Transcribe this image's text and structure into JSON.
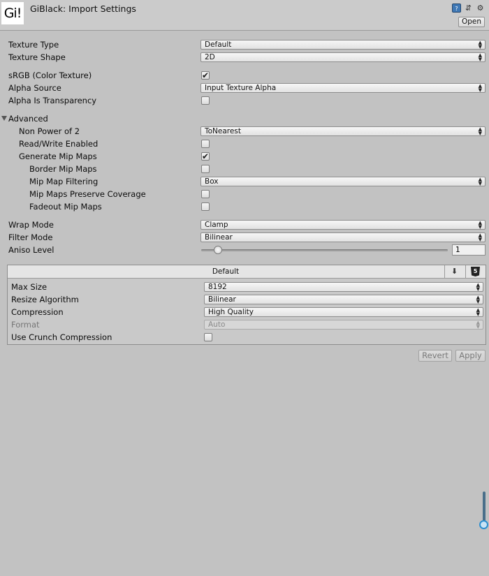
{
  "header": {
    "logo_text": "Gi!",
    "title": "GiBlack: Import Settings",
    "open_label": "Open",
    "icons": [
      "help-book-icon",
      "preset-sliders-icon",
      "settings-gear-icon"
    ]
  },
  "fields": {
    "texture_type": {
      "label": "Texture Type",
      "value": "Default"
    },
    "texture_shape": {
      "label": "Texture Shape",
      "value": "2D"
    },
    "srgb": {
      "label": "sRGB (Color Texture)",
      "checked": true
    },
    "alpha_source": {
      "label": "Alpha Source",
      "value": "Input Texture Alpha"
    },
    "alpha_is_transparency": {
      "label": "Alpha Is Transparency",
      "checked": false
    },
    "advanced": {
      "label": "Advanced",
      "expanded": true
    },
    "non_power_of_2": {
      "label": "Non Power of 2",
      "value": "ToNearest"
    },
    "read_write": {
      "label": "Read/Write Enabled",
      "checked": false
    },
    "generate_mips": {
      "label": "Generate Mip Maps",
      "checked": true
    },
    "border_mips": {
      "label": "Border Mip Maps",
      "checked": false
    },
    "mip_filtering": {
      "label": "Mip Map Filtering",
      "value": "Box"
    },
    "mip_preserve": {
      "label": "Mip Maps Preserve Coverage",
      "checked": false
    },
    "fadeout_mips": {
      "label": "Fadeout Mip Maps",
      "checked": false
    },
    "wrap_mode": {
      "label": "Wrap Mode",
      "value": "Clamp"
    },
    "filter_mode": {
      "label": "Filter Mode",
      "value": "Bilinear"
    },
    "aniso_level": {
      "label": "Aniso Level",
      "value": "1",
      "min": 0,
      "max": 16
    }
  },
  "platform": {
    "tab_label": "Default",
    "max_size": {
      "label": "Max Size",
      "value": "8192"
    },
    "resize_algorithm": {
      "label": "Resize Algorithm",
      "value": "Bilinear"
    },
    "compression": {
      "label": "Compression",
      "value": "High Quality"
    },
    "format": {
      "label": "Format",
      "value": "Auto",
      "disabled": true
    },
    "crunch": {
      "label": "Use Crunch Compression",
      "checked": false
    }
  },
  "buttons": {
    "revert": "Revert",
    "apply": "Apply"
  },
  "symbols": {
    "check": "✔",
    "dropdown_arrow_up": "▲",
    "dropdown_arrow_down": "▼",
    "html5": "5",
    "download": "⬇",
    "book": "?",
    "sliders": "⇵",
    "gear": "⚙"
  },
  "colors": {
    "background": "#c2c2c2",
    "header": "#cbcbcb",
    "platform_tab": "#e5e5e5",
    "scroll_accent": "#2c8fd0"
  }
}
